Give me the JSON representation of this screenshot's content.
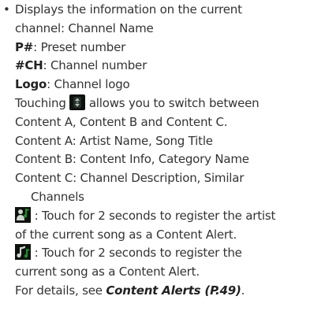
{
  "bullet": "•",
  "intro": {
    "line1": "Displays the information on the current",
    "line2": "channel: Channel Name"
  },
  "definitions": [
    {
      "term": "P#",
      "desc": ": Preset number"
    },
    {
      "term": "#CH",
      "desc": ": Channel number"
    },
    {
      "term": "Logo",
      "desc": ": Channel logo"
    }
  ],
  "touching": {
    "prefix": "Touching",
    "icon": "content-switch-icon",
    "suffix": "allows you to switch between",
    "line2": "Content A, Content B and Content C."
  },
  "contents": {
    "a": "Content A: Artist Name, Song Title",
    "b": "Content B: Content Info, Category Name",
    "c_line1": "Content C: Channel Description, Similar",
    "c_line2": "Channels"
  },
  "artist_alert": {
    "icon": "artist-alert-icon",
    "line1": ": Touch for 2 seconds to register the artist",
    "line2": "of the current song as a Content Alert."
  },
  "song_alert": {
    "icon": "song-alert-icon",
    "line1": ": Touch for 2 seconds to register the",
    "line2": "current song as a Content Alert."
  },
  "details": {
    "prefix": "For details, see ",
    "link": "Content Alerts (P.49)",
    "suffix": "."
  },
  "colors": {
    "text": "#333333",
    "icon_bg": "#0e120e",
    "icon_green": "#1f8a2a",
    "icon_light": "#cfd6cf"
  }
}
